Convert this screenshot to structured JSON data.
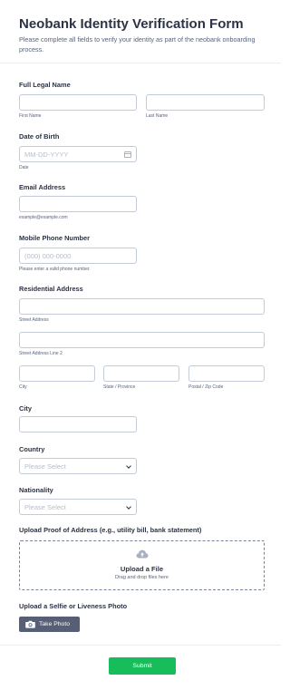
{
  "form": {
    "title": "Neobank Identity Verification Form",
    "subtitle": "Please complete all fields to verify your identity as part of the neobank onboarding process."
  },
  "full_name": {
    "label": "Full Legal Name",
    "first_sub": "First Name",
    "last_sub": "Last Name"
  },
  "dob": {
    "label": "Date of Birth",
    "placeholder": "MM-DD-YYYY",
    "sub": "Date",
    "icon": "calendar-icon"
  },
  "email": {
    "label": "Email Address",
    "sub": "example@example.com"
  },
  "phone": {
    "label": "Mobile Phone Number",
    "placeholder": "(000) 000-0000",
    "sub": "Please enter a valid phone number."
  },
  "address": {
    "label": "Residential Address",
    "street_sub": "Street Address",
    "street2_sub": "Street Address Line 2",
    "city_sub": "City",
    "state_sub": "State / Province",
    "zip_sub": "Postal / Zip Code"
  },
  "city": {
    "label": "City"
  },
  "country": {
    "label": "Country",
    "selected": "Please Select"
  },
  "nationality": {
    "label": "Nationality",
    "selected": "Please Select"
  },
  "proof": {
    "label": "Upload Proof of Address (e.g., utility bill, bank statement)",
    "title": "Upload a File",
    "sub": "Drag and drop files here",
    "icon": "cloud-upload-icon"
  },
  "selfie": {
    "label": "Upload a Selfie or Liveness Photo",
    "button": "Take Photo",
    "icon": "camera-icon"
  },
  "submit": {
    "label": "Submit"
  },
  "colors": {
    "submit": "#18bd5b",
    "photo_button": "#565f75",
    "text": "#2c3345",
    "border": "#c3cad8"
  }
}
